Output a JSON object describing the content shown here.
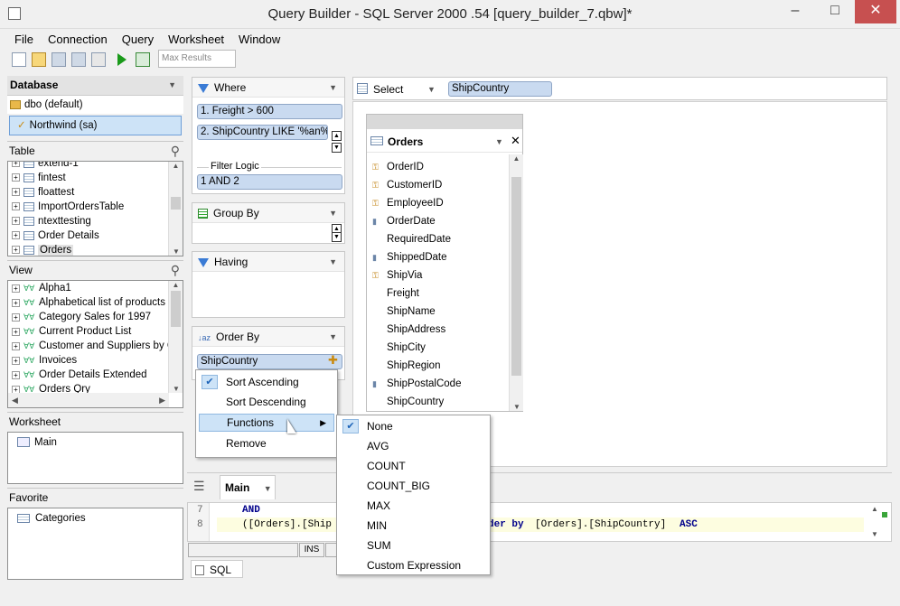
{
  "window": {
    "title": "Query Builder - SQL Server 2000 .54 [query_builder_7.qbw]*"
  },
  "menu": [
    "File",
    "Connection",
    "Query",
    "Worksheet",
    "Window"
  ],
  "toolbar": {
    "max_results_placeholder": "Max Results"
  },
  "database": {
    "header": "Database",
    "schema": "dbo (default)",
    "connection": "Northwind (sa)"
  },
  "table_section": {
    "label": "Table",
    "items": [
      "extend-1",
      "fintest",
      "floattest",
      "ImportOrdersTable",
      "ntexttesting",
      "Order Details",
      "Orders"
    ]
  },
  "view_section": {
    "label": "View",
    "items": [
      "Alpha1",
      "Alphabetical list of products",
      "Category Sales for 1997",
      "Current Product List",
      "Customer and Suppliers by C",
      "Invoices",
      "Order Details Extended",
      "Orders Qry"
    ]
  },
  "worksheet_section": {
    "label": "Worksheet",
    "items": [
      "Main"
    ]
  },
  "favorite_section": {
    "label": "Favorite",
    "items": [
      "Categories"
    ]
  },
  "where": {
    "label": "Where",
    "conditions": [
      "1. Freight > 600",
      "2. ShipCountry LIKE '%an%'"
    ],
    "filter_logic_label": "Filter Logic",
    "filter_logic": "1 AND 2"
  },
  "group_by": {
    "label": "Group By"
  },
  "having": {
    "label": "Having"
  },
  "order_by": {
    "label": "Order By",
    "field": "ShipCountry"
  },
  "select": {
    "label": "Select",
    "field": "ShipCountry"
  },
  "orders_table": {
    "title": "Orders",
    "fields": [
      "OrderID",
      "CustomerID",
      "EmployeeID",
      "OrderDate",
      "RequiredDate",
      "ShippedDate",
      "ShipVia",
      "Freight",
      "ShipName",
      "ShipAddress",
      "ShipCity",
      "ShipRegion",
      "ShipPostalCode",
      "ShipCountry"
    ]
  },
  "sort_menu": {
    "items": [
      "Sort Ascending",
      "Sort Descending",
      "Functions",
      "Remove"
    ],
    "checked": "Sort Ascending"
  },
  "functions_menu": {
    "items": [
      "None",
      "AVG",
      "COUNT",
      "COUNT_BIG",
      "MAX",
      "MIN",
      "SUM",
      "Custom Expression"
    ],
    "checked": "None"
  },
  "editor": {
    "tab": "Main",
    "line7_no": "7",
    "line8_no": "8",
    "line7": "AND",
    "line8_left": "([Orders].[Ship",
    "line8_keyword": "der by",
    "line8_right": "[Orders].[ShipCountry]",
    "line8_asc": "ASC",
    "status_ins": "INS",
    "bottom_tab": "SQL"
  },
  "colors": {
    "accent": "#c9daf0",
    "close": "#c75050",
    "keyword": "#00008b"
  }
}
